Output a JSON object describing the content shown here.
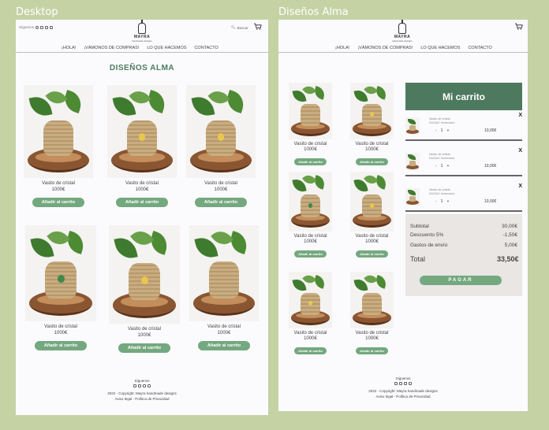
{
  "frames": {
    "desktop_label": "Desktop",
    "mobile_label": "Diseños Alma"
  },
  "header": {
    "follow_label": "Síguenos",
    "search_label": "Buscar",
    "brand": "MAYRA",
    "brand_sub": "handmade designs",
    "nav": [
      "¡HOLA!",
      "¡VÁMONOS DE COMPRAS!",
      "LO QUE HACEMOS",
      "CONTACTO"
    ]
  },
  "desktop": {
    "title": "DISEÑOS ALMA",
    "products": [
      {
        "name": "Vasito de cristal",
        "price": "1000€",
        "button": "Añadir al carrito"
      },
      {
        "name": "Vasito de cristal",
        "price": "1000€",
        "button": "Añadir al carrito"
      },
      {
        "name": "Vasito de cristal",
        "price": "1000€",
        "button": "Añadir al carrito"
      },
      {
        "name": "Vasito de cristal",
        "price": "1000€",
        "button": "Añadir al carrito"
      },
      {
        "name": "Vasito de cristal",
        "price": "1000€",
        "button": "Añadir al carrito"
      },
      {
        "name": "Vasito de cristal",
        "price": "1000€",
        "button": "Añadir al carrito"
      }
    ]
  },
  "mobile": {
    "products": [
      {
        "name": "Vasito de cristal",
        "price": "1000€",
        "button": "Añadir al carrito"
      },
      {
        "name": "Vasito de cristal",
        "price": "1000€",
        "button": "Añadir al carrito"
      },
      {
        "name": "Vasito de cristal",
        "price": "1000€",
        "button": "Añadir al carrito"
      },
      {
        "name": "Vasito de cristal",
        "price": "1000€",
        "button": "Añadir al carrito"
      },
      {
        "name": "Vasito de cristal",
        "price": "1000€",
        "button": "Añadir al carrito"
      },
      {
        "name": "Vasito de cristal",
        "price": "1000€",
        "button": "Añadir al carrito"
      }
    ]
  },
  "cart": {
    "title": "Mi carrito",
    "items": [
      {
        "desc": "Vasito de cristal",
        "desc2": "DUGAC Invernaolo",
        "qty": "1",
        "price": "10,00€",
        "remove": "X"
      },
      {
        "desc": "Vasito de cristal",
        "desc2": "DUGAC Invernaolo",
        "qty": "1",
        "price": "10,00€",
        "remove": "X"
      },
      {
        "desc": "Vasito de cristal",
        "desc2": "DUGAC Invernaolo",
        "qty": "1",
        "price": "10,00€",
        "remove": "X"
      }
    ],
    "qty_minus": "-",
    "qty_plus": "+",
    "subtotal_label": "Subtotal",
    "subtotal": "30,00€",
    "discount_label": "Descuento 5%",
    "discount": "-1,50€",
    "shipping_label": "Gastos de envío",
    "shipping": "5,00€",
    "total_label": "Total",
    "total": "33,50€",
    "pay_button": "PAGAR"
  },
  "footer": {
    "follow": "Síguenos",
    "copyright": "2022 - Copyright: Mayra handmade designs",
    "legal": "Aviso legal - Política de Privacidad"
  },
  "colors": {
    "accent": "#74a87f",
    "cart_header": "#4d7a5e",
    "background": "#c5d2a4"
  }
}
